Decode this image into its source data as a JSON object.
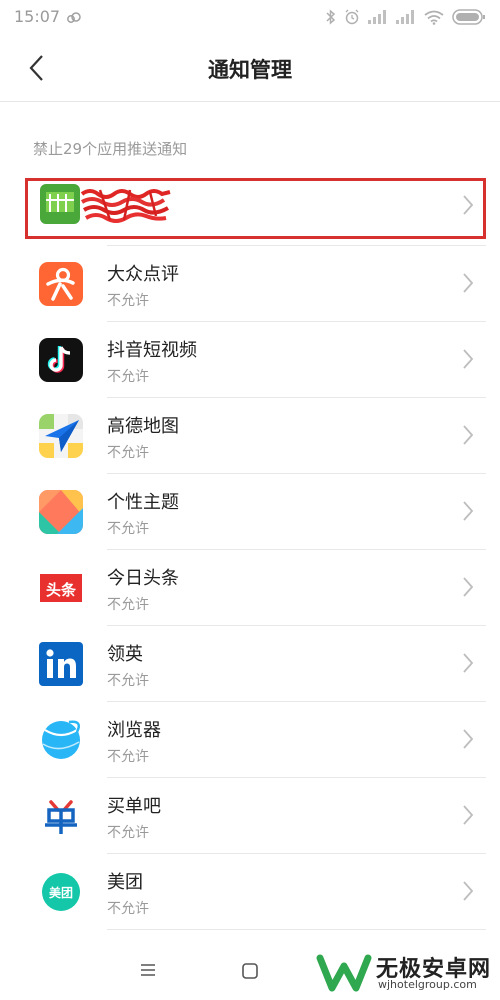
{
  "status_bar": {
    "time": "15:07"
  },
  "header": {
    "title": "通知管理"
  },
  "section_label": "禁止29个应用推送通知",
  "apps": [
    {
      "name": "",
      "status": "",
      "icon": "redacted-app-icon"
    },
    {
      "name": "大众点评",
      "status": "不允许",
      "icon": "dianping-icon"
    },
    {
      "name": "抖音短视频",
      "status": "不允许",
      "icon": "douyin-icon"
    },
    {
      "name": "高德地图",
      "status": "不允许",
      "icon": "amap-icon"
    },
    {
      "name": "个性主题",
      "status": "不允许",
      "icon": "themes-icon"
    },
    {
      "name": "今日头条",
      "status": "不允许",
      "icon": "toutiao-icon"
    },
    {
      "name": "领英",
      "status": "不允许",
      "icon": "linkedin-icon"
    },
    {
      "name": "浏览器",
      "status": "不允许",
      "icon": "browser-icon"
    },
    {
      "name": "买单吧",
      "status": "不允许",
      "icon": "maidanba-icon"
    },
    {
      "name": "美团",
      "status": "不允许",
      "icon": "meituan-icon"
    }
  ],
  "watermark": {
    "title": "无极安卓网",
    "url": "wjhotelgroup.com"
  },
  "colors": {
    "highlight": "#d6302f",
    "dianping": "#ff6633",
    "meituan": "#13c7a8"
  }
}
